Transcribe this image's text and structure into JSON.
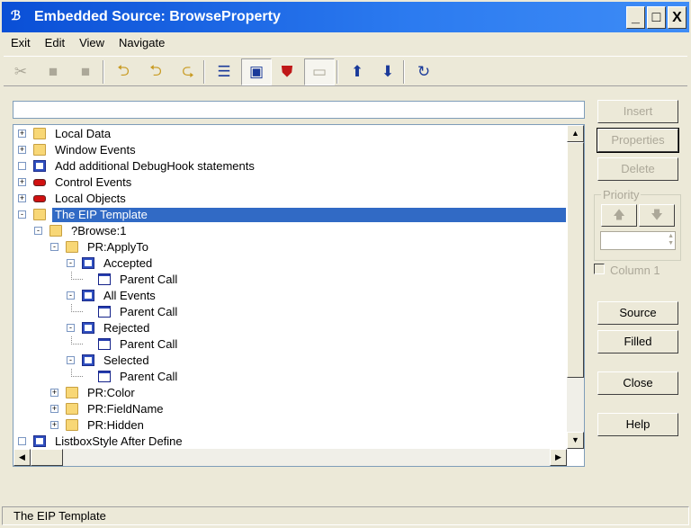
{
  "window": {
    "title": "Embedded Source: BrowseProperty",
    "controls": [
      "_",
      "□",
      "X"
    ]
  },
  "menu": [
    "Exit",
    "Edit",
    "View",
    "Navigate"
  ],
  "toolbar": [
    {
      "icon": "cut-icon",
      "enabled": false
    },
    {
      "icon": "copy-icon",
      "enabled": false
    },
    {
      "icon": "paste-icon",
      "enabled": false
    },
    {
      "icon": "folder-next-icon",
      "enabled": true
    },
    {
      "icon": "folder-next-filled-icon",
      "enabled": true
    },
    {
      "icon": "folder-prev-icon",
      "enabled": true
    },
    {
      "icon": "embed-list-icon",
      "enabled": true
    },
    {
      "icon": "screen-embed-icon",
      "enabled": true,
      "pressed": true
    },
    {
      "icon": "shield-icon",
      "enabled": true
    },
    {
      "icon": "form-icon",
      "enabled": false,
      "pressed": true
    },
    {
      "icon": "move-up-icon",
      "enabled": true
    },
    {
      "icon": "move-down-icon",
      "enabled": true
    },
    {
      "icon": "refresh-icon",
      "enabled": true
    }
  ],
  "filter": {
    "value": ""
  },
  "tree": [
    {
      "label": "Local Data",
      "level": 0,
      "icon": "folder",
      "exp": "+"
    },
    {
      "label": "Window Events",
      "level": 0,
      "icon": "folder",
      "exp": "+"
    },
    {
      "label": "Add additional DebugHook statements",
      "level": 0,
      "icon": "embed",
      "exp": "box"
    },
    {
      "label": "Control Events",
      "level": 0,
      "icon": "ctrl",
      "exp": "+"
    },
    {
      "label": "Local Objects",
      "level": 0,
      "icon": "ctrl",
      "exp": "+"
    },
    {
      "label": "The EIP Template",
      "level": 0,
      "icon": "folder",
      "exp": "-",
      "selected": true
    },
    {
      "label": "?Browse:1",
      "level": 1,
      "icon": "folder",
      "exp": "-"
    },
    {
      "label": "PR:ApplyTo",
      "level": 2,
      "icon": "folder",
      "exp": "-"
    },
    {
      "label": "Accepted",
      "level": 3,
      "icon": "embed",
      "exp": "-"
    },
    {
      "label": "Parent Call",
      "level": 4,
      "icon": "doc",
      "exp": ""
    },
    {
      "label": "All Events",
      "level": 3,
      "icon": "embed",
      "exp": "-"
    },
    {
      "label": "Parent Call",
      "level": 4,
      "icon": "doc",
      "exp": ""
    },
    {
      "label": "Rejected",
      "level": 3,
      "icon": "embed",
      "exp": "-"
    },
    {
      "label": "Parent Call",
      "level": 4,
      "icon": "doc",
      "exp": ""
    },
    {
      "label": "Selected",
      "level": 3,
      "icon": "embed",
      "exp": "-"
    },
    {
      "label": "Parent Call",
      "level": 4,
      "icon": "doc",
      "exp": ""
    },
    {
      "label": "PR:Color",
      "level": 2,
      "icon": "folder",
      "exp": "+"
    },
    {
      "label": "PR:FieldName",
      "level": 2,
      "icon": "folder",
      "exp": "+"
    },
    {
      "label": "PR:Hidden",
      "level": 2,
      "icon": "folder",
      "exp": "+"
    },
    {
      "label": "ListboxStyle After Define",
      "level": 0,
      "icon": "embed",
      "exp": "box"
    }
  ],
  "buttons": {
    "insert": "Insert",
    "properties": "Properties",
    "delete": "Delete",
    "source": "Source",
    "filled": "Filled",
    "close": "Close",
    "help": "Help"
  },
  "priority": {
    "label": "Priority",
    "value": ""
  },
  "column_checkbox": {
    "label": "Column 1",
    "checked": false
  },
  "status": "The EIP Template"
}
